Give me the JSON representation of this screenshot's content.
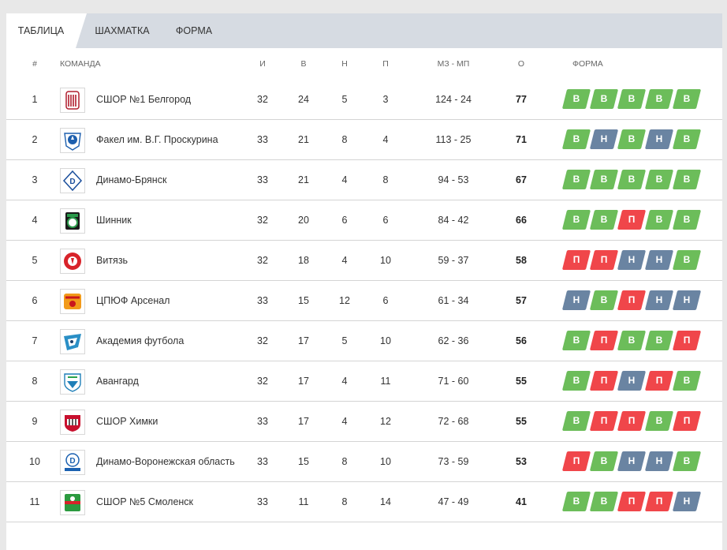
{
  "tabs": [
    {
      "label": "ТАБЛИЦА",
      "active": true
    },
    {
      "label": "ШАХМАТКА",
      "active": false
    },
    {
      "label": "ФОРМА",
      "active": false
    }
  ],
  "columns": {
    "num": "#",
    "team": "КОМАНДА",
    "played": "И",
    "wins": "В",
    "draws": "Н",
    "losses": "П",
    "goals": "МЗ - МП",
    "points": "О",
    "form": "ФОРМА"
  },
  "colors": {
    "win": "#6cbd5a",
    "draw": "#6a84a2",
    "loss": "#f0464a"
  },
  "rows": [
    {
      "pos": "1",
      "team": "СШОР №1 Белгород",
      "logo": "belgorod-logo-icon",
      "played": "32",
      "w": "24",
      "d": "5",
      "l": "3",
      "goals": "124 - 24",
      "pts": "77",
      "form": [
        "В",
        "В",
        "В",
        "В",
        "В"
      ]
    },
    {
      "pos": "2",
      "team": "Факел им. В.Г. Проскурина",
      "logo": "fakel-logo-icon",
      "played": "33",
      "w": "21",
      "d": "8",
      "l": "4",
      "goals": "113 - 25",
      "pts": "71",
      "form": [
        "В",
        "Н",
        "В",
        "Н",
        "В"
      ]
    },
    {
      "pos": "3",
      "team": "Динамо-Брянск",
      "logo": "dinamo-bryansk-logo-icon",
      "played": "33",
      "w": "21",
      "d": "4",
      "l": "8",
      "goals": "94 - 53",
      "pts": "67",
      "form": [
        "В",
        "В",
        "В",
        "В",
        "В"
      ]
    },
    {
      "pos": "4",
      "team": "Шинник",
      "logo": "shinnik-logo-icon",
      "played": "32",
      "w": "20",
      "d": "6",
      "l": "6",
      "goals": "84 - 42",
      "pts": "66",
      "form": [
        "В",
        "В",
        "П",
        "В",
        "В"
      ]
    },
    {
      "pos": "5",
      "team": "Витязь",
      "logo": "vityaz-logo-icon",
      "played": "32",
      "w": "18",
      "d": "4",
      "l": "10",
      "goals": "59 - 37",
      "pts": "58",
      "form": [
        "П",
        "П",
        "Н",
        "Н",
        "В"
      ]
    },
    {
      "pos": "6",
      "team": "ЦПЮФ Арсенал",
      "logo": "arsenal-logo-icon",
      "played": "33",
      "w": "15",
      "d": "12",
      "l": "6",
      "goals": "61 - 34",
      "pts": "57",
      "form": [
        "Н",
        "В",
        "П",
        "Н",
        "Н"
      ]
    },
    {
      "pos": "7",
      "team": "Академия футбола",
      "logo": "akademiya-logo-icon",
      "played": "32",
      "w": "17",
      "d": "5",
      "l": "10",
      "goals": "62 - 36",
      "pts": "56",
      "form": [
        "В",
        "П",
        "В",
        "В",
        "П"
      ]
    },
    {
      "pos": "8",
      "team": "Авангард",
      "logo": "avangard-logo-icon",
      "played": "32",
      "w": "17",
      "d": "4",
      "l": "11",
      "goals": "71 - 60",
      "pts": "55",
      "form": [
        "В",
        "П",
        "Н",
        "П",
        "В"
      ]
    },
    {
      "pos": "9",
      "team": "СШОР Химки",
      "logo": "khimki-logo-icon",
      "played": "33",
      "w": "17",
      "d": "4",
      "l": "12",
      "goals": "72 - 68",
      "pts": "55",
      "form": [
        "В",
        "П",
        "П",
        "В",
        "П"
      ]
    },
    {
      "pos": "10",
      "team": "Динамо-Воронежская область",
      "logo": "dinamo-voronezh-logo-icon",
      "played": "33",
      "w": "15",
      "d": "8",
      "l": "10",
      "goals": "73 - 59",
      "pts": "53",
      "form": [
        "П",
        "В",
        "Н",
        "Н",
        "В"
      ]
    },
    {
      "pos": "11",
      "team": "СШОР №5 Смоленск",
      "logo": "smolensk-logo-icon",
      "played": "33",
      "w": "11",
      "d": "8",
      "l": "14",
      "goals": "47 - 49",
      "pts": "41",
      "form": [
        "В",
        "В",
        "П",
        "П",
        "Н"
      ]
    }
  ]
}
